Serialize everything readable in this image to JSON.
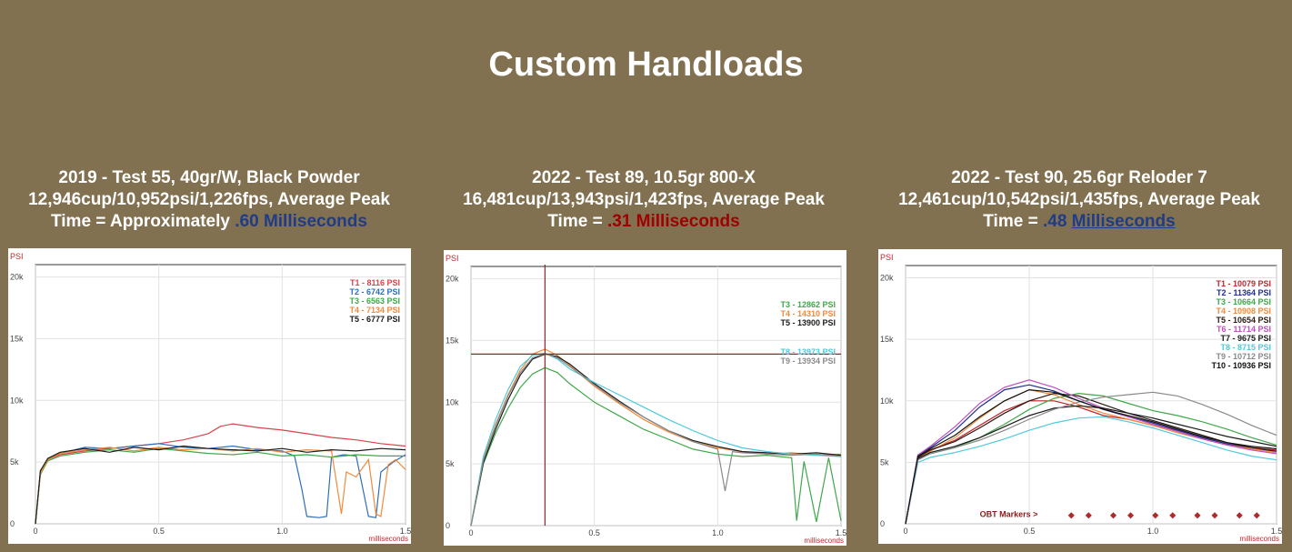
{
  "page_title": "Custom Handloads",
  "panels": [
    {
      "caption_line1": "2019 - Test 55, 40gr/W, Black Powder",
      "caption_line2": "12,946cup/10,952psi/1,226fps, Average Peak",
      "caption_time_prefix": "Time = Approximately",
      "caption_time_value": ".60",
      "caption_time_unit": "Milliseconds"
    },
    {
      "caption_line1": "2022 - Test 89, 10.5gr 800-X",
      "caption_line2": "16,481cup/13,943psi/1,423fps, Average Peak",
      "caption_time_prefix": "Time =",
      "caption_time_value": ".31",
      "caption_time_unit": "Milliseconds"
    },
    {
      "caption_line1": "2022 - Test 90, 25.6gr Reloder 7",
      "caption_line2": "12,461cup/10,542psi/1,435fps, Average Peak",
      "caption_time_prefix": "Time =",
      "caption_time_value": ".48",
      "caption_time_unit": "Milliseconds"
    }
  ],
  "chart_data": [
    {
      "type": "line",
      "ylabel": "PSI",
      "xlabel": "milliseconds",
      "xlim": [
        0,
        1.5
      ],
      "ylim": [
        0,
        21000
      ],
      "x_ticks": [
        "0",
        "0.5",
        "1.0",
        "1.5"
      ],
      "y_ticks": [
        "0",
        "5k",
        "10k",
        "15k",
        "20k"
      ],
      "grid": true,
      "legend_position": "top-right",
      "series": [
        {
          "name": "T1 -  8116 PSI",
          "color": "#d9434b",
          "x": [
            0,
            0.02,
            0.05,
            0.1,
            0.2,
            0.3,
            0.4,
            0.5,
            0.6,
            0.7,
            0.75,
            0.8,
            0.9,
            1.0,
            1.1,
            1.2,
            1.3,
            1.4,
            1.5
          ],
          "y": [
            0,
            4000,
            5200,
            5600,
            5900,
            6100,
            6300,
            6500,
            6800,
            7300,
            7900,
            8100,
            7800,
            7600,
            7300,
            7000,
            6800,
            6500,
            6300
          ]
        },
        {
          "name": "T2 -  6742 PSI",
          "color": "#2f6fb5",
          "x": [
            0,
            0.02,
            0.05,
            0.1,
            0.2,
            0.3,
            0.4,
            0.5,
            0.6,
            0.7,
            0.8,
            0.9,
            1.0,
            1.05,
            1.08,
            1.1,
            1.15,
            1.18,
            1.2,
            1.25,
            1.3,
            1.35,
            1.38,
            1.4,
            1.45,
            1.5
          ],
          "y": [
            0,
            4200,
            5300,
            5700,
            6200,
            6100,
            6300,
            6500,
            6200,
            6100,
            6300,
            6000,
            5900,
            5500,
            2800,
            600,
            500,
            600,
            5400,
            5600,
            5500,
            600,
            500,
            4200,
            5000,
            5600
          ]
        },
        {
          "name": "T3 -  6563 PSI",
          "color": "#3fa84a",
          "x": [
            0,
            0.02,
            0.05,
            0.1,
            0.2,
            0.3,
            0.4,
            0.5,
            0.6,
            0.7,
            0.8,
            0.9,
            1.0,
            1.1,
            1.2,
            1.3,
            1.4,
            1.5
          ],
          "y": [
            0,
            4000,
            5100,
            5500,
            5800,
            6000,
            5800,
            6100,
            5900,
            5700,
            5600,
            5800,
            5500,
            5600,
            5400,
            5600,
            5500,
            5500
          ]
        },
        {
          "name": "T4 -  7134 PSI",
          "color": "#f28a3b",
          "x": [
            0,
            0.02,
            0.05,
            0.1,
            0.2,
            0.3,
            0.4,
            0.5,
            0.6,
            0.7,
            0.8,
            0.9,
            1.0,
            1.1,
            1.2,
            1.24,
            1.26,
            1.3,
            1.35,
            1.38,
            1.4,
            1.43,
            1.46,
            1.5
          ],
          "y": [
            0,
            4100,
            5200,
            5700,
            6000,
            6200,
            5900,
            6200,
            6000,
            6100,
            5900,
            6100,
            5800,
            6000,
            5900,
            800,
            4200,
            3800,
            5200,
            800,
            600,
            4800,
            5200,
            4400
          ]
        },
        {
          "name": "T5 -  6777 PSI",
          "color": "#1b1b1b",
          "x": [
            0,
            0.02,
            0.05,
            0.1,
            0.2,
            0.3,
            0.4,
            0.5,
            0.6,
            0.7,
            0.8,
            0.9,
            1.0,
            1.1,
            1.2,
            1.3,
            1.4,
            1.5
          ],
          "y": [
            0,
            4300,
            5300,
            5800,
            6100,
            5800,
            6200,
            6000,
            6300,
            6100,
            6000,
            5900,
            6100,
            5800,
            6000,
            5900,
            6100,
            6000
          ]
        }
      ]
    },
    {
      "type": "line",
      "ylabel": "PSI",
      "xlabel": "milliseconds",
      "xlim": [
        0,
        1.5
      ],
      "ylim": [
        0,
        21000
      ],
      "x_ticks": [
        "0",
        "0.5",
        "1.0",
        "1.5"
      ],
      "y_ticks": [
        "0",
        "5k",
        "10k",
        "15k",
        "20k"
      ],
      "grid": true,
      "legend_position": "right",
      "cursor": {
        "x": 0.3,
        "y": 13900,
        "color": "#8b2a2a"
      },
      "series": [
        {
          "name": "T3 -  12862 PSI",
          "color": "#3fa84a",
          "x": [
            0,
            0.05,
            0.1,
            0.15,
            0.2,
            0.25,
            0.3,
            0.35,
            0.4,
            0.5,
            0.6,
            0.7,
            0.8,
            0.9,
            1.0,
            1.1,
            1.2,
            1.3,
            1.32,
            1.35,
            1.4,
            1.45,
            1.5
          ],
          "y": [
            0,
            5000,
            7500,
            9500,
            11200,
            12300,
            12800,
            12400,
            11500,
            10000,
            8900,
            7800,
            7000,
            6200,
            5800,
            5600,
            5700,
            5500,
            400,
            5200,
            300,
            5500,
            400
          ]
        },
        {
          "name": "T4 -  14310 PSI",
          "color": "#f28a3b",
          "x": [
            0,
            0.05,
            0.1,
            0.15,
            0.2,
            0.25,
            0.3,
            0.35,
            0.4,
            0.5,
            0.6,
            0.7,
            0.8,
            0.9,
            1.0,
            1.1,
            1.2,
            1.3,
            1.4,
            1.5
          ],
          "y": [
            0,
            5400,
            8200,
            10600,
            12600,
            13900,
            14300,
            13800,
            13000,
            11300,
            9900,
            8600,
            7600,
            6800,
            6300,
            6000,
            5800,
            5900,
            5700,
            5800
          ]
        },
        {
          "name": "T5 -  13900 PSI",
          "color": "#1b1b1b",
          "x": [
            0,
            0.05,
            0.1,
            0.15,
            0.2,
            0.25,
            0.3,
            0.35,
            0.4,
            0.5,
            0.6,
            0.7,
            0.8,
            0.9,
            1.0,
            1.1,
            1.2,
            1.3,
            1.4,
            1.5
          ],
          "y": [
            0,
            5100,
            7800,
            10200,
            12200,
            13500,
            13900,
            13700,
            13100,
            11500,
            10100,
            8800,
            7700,
            6900,
            6400,
            6000,
            5900,
            5800,
            5900,
            5700
          ]
        },
        {
          "name": "T8 -  13973 PSI",
          "color": "#4fc9dc",
          "x": [
            0,
            0.05,
            0.1,
            0.15,
            0.2,
            0.25,
            0.3,
            0.35,
            0.4,
            0.5,
            0.6,
            0.7,
            0.8,
            0.9,
            1.0,
            1.1,
            1.2,
            1.3,
            1.4,
            1.5
          ],
          "y": [
            0,
            5600,
            8600,
            11000,
            12900,
            13800,
            13970,
            13500,
            12700,
            11600,
            10600,
            9600,
            8600,
            7700,
            6900,
            6300,
            6000,
            5800,
            5700,
            5600
          ]
        },
        {
          "name": "T9 -  13934 PSI",
          "color": "#8a8a8a",
          "x": [
            0,
            0.05,
            0.1,
            0.15,
            0.2,
            0.25,
            0.3,
            0.35,
            0.4,
            0.5,
            0.6,
            0.7,
            0.8,
            0.9,
            1.0,
            1.03,
            1.06,
            1.1,
            1.2,
            1.3,
            1.4,
            1.5
          ],
          "y": [
            0,
            5300,
            8100,
            10500,
            12400,
            13600,
            13930,
            13600,
            12900,
            11400,
            10000,
            8800,
            7700,
            6800,
            6200,
            2800,
            6000,
            5900,
            5800,
            5700,
            5800,
            5600
          ]
        }
      ]
    },
    {
      "type": "line",
      "ylabel": "PSI",
      "xlabel": "milliseconds",
      "xlim": [
        0,
        1.5
      ],
      "ylim": [
        0,
        21000
      ],
      "x_ticks": [
        "0",
        "0.5",
        "1.0",
        "1.5"
      ],
      "y_ticks": [
        "0",
        "5k",
        "10k",
        "15k",
        "20k"
      ],
      "grid": true,
      "legend_position": "top-right",
      "obt_label": "OBT Markers >",
      "obt_markers": [
        0.67,
        0.74,
        0.84,
        0.91,
        1.01,
        1.08,
        1.18,
        1.25,
        1.35,
        1.42
      ],
      "series": [
        {
          "name": "T1 -  10079 PSI",
          "color": "#c1272d",
          "x": [
            0,
            0.05,
            0.1,
            0.2,
            0.3,
            0.4,
            0.5,
            0.6,
            0.7,
            0.8,
            0.9,
            1.0,
            1.1,
            1.2,
            1.3,
            1.4,
            1.5
          ],
          "y": [
            0,
            5500,
            6000,
            6800,
            8000,
            9200,
            10000,
            10000,
            9500,
            8800,
            8500,
            8000,
            7600,
            7000,
            6500,
            6200,
            6000
          ]
        },
        {
          "name": "T2 -  11364 PSI",
          "color": "#1f2f8f",
          "x": [
            0,
            0.05,
            0.1,
            0.2,
            0.3,
            0.4,
            0.5,
            0.6,
            0.7,
            0.8,
            0.9,
            1.0,
            1.1,
            1.2,
            1.3,
            1.4,
            1.5
          ],
          "y": [
            0,
            5600,
            6200,
            7600,
            9500,
            10900,
            11300,
            10800,
            10000,
            9300,
            8700,
            8200,
            7600,
            7000,
            6500,
            6100,
            5900
          ]
        },
        {
          "name": "T3 -  10664 PSI",
          "color": "#3fa84a",
          "x": [
            0,
            0.05,
            0.1,
            0.2,
            0.3,
            0.4,
            0.5,
            0.6,
            0.7,
            0.8,
            0.9,
            1.0,
            1.1,
            1.2,
            1.3,
            1.4,
            1.5
          ],
          "y": [
            0,
            5200,
            5700,
            6200,
            7000,
            8100,
            9300,
            10200,
            10600,
            10400,
            9800,
            9200,
            8800,
            8300,
            7700,
            7000,
            6400
          ]
        },
        {
          "name": "T4 -  10908 PSI",
          "color": "#f28a3b",
          "x": [
            0,
            0.05,
            0.1,
            0.2,
            0.3,
            0.4,
            0.5,
            0.6,
            0.7,
            0.8,
            0.9,
            1.0,
            1.1,
            1.2,
            1.3,
            1.4,
            1.5
          ],
          "y": [
            0,
            5300,
            5900,
            7000,
            8600,
            10000,
            10900,
            10500,
            9700,
            9000,
            8500,
            8000,
            7400,
            6900,
            6400,
            6100,
            5800
          ]
        },
        {
          "name": "T5 -  10654 PSI",
          "color": "#2b1a14",
          "x": [
            0,
            0.05,
            0.1,
            0.2,
            0.3,
            0.4,
            0.5,
            0.6,
            0.7,
            0.8,
            0.9,
            1.0,
            1.1,
            1.2,
            1.3,
            1.4,
            1.5
          ],
          "y": [
            0,
            5400,
            6000,
            6700,
            7800,
            9000,
            10000,
            10600,
            10400,
            9700,
            9000,
            8400,
            7800,
            7200,
            6600,
            6200,
            5900
          ]
        },
        {
          "name": "T6 -  11714 PSI",
          "color": "#c04fc0",
          "x": [
            0,
            0.05,
            0.1,
            0.2,
            0.3,
            0.4,
            0.5,
            0.6,
            0.7,
            0.8,
            0.9,
            1.0,
            1.1,
            1.2,
            1.3,
            1.4,
            1.5
          ],
          "y": [
            0,
            5600,
            6300,
            7900,
            9800,
            11100,
            11700,
            11100,
            10200,
            9400,
            8700,
            8100,
            7500,
            6900,
            6400,
            6000,
            5700
          ]
        },
        {
          "name": "T7 -   9675 PSI",
          "color": "#1b1b1b",
          "x": [
            0,
            0.05,
            0.1,
            0.2,
            0.3,
            0.4,
            0.5,
            0.6,
            0.7,
            0.8,
            0.9,
            1.0,
            1.1,
            1.2,
            1.3,
            1.4,
            1.5
          ],
          "y": [
            0,
            5300,
            5800,
            6300,
            7000,
            7900,
            8800,
            9400,
            9600,
            9400,
            9000,
            8600,
            8100,
            7600,
            7100,
            6700,
            6300
          ]
        },
        {
          "name": "T8 -   8715 PSI",
          "color": "#4fc9dc",
          "x": [
            0,
            0.05,
            0.1,
            0.2,
            0.3,
            0.4,
            0.5,
            0.6,
            0.7,
            0.8,
            0.9,
            1.0,
            1.1,
            1.2,
            1.3,
            1.4,
            1.5
          ],
          "y": [
            0,
            5000,
            5400,
            5800,
            6300,
            6900,
            7600,
            8200,
            8600,
            8700,
            8300,
            7800,
            7200,
            6600,
            6000,
            5500,
            5200
          ]
        },
        {
          "name": "T9 -  10712 PSI",
          "color": "#8a8a8a",
          "x": [
            0,
            0.05,
            0.1,
            0.2,
            0.3,
            0.4,
            0.5,
            0.6,
            0.7,
            0.8,
            0.9,
            1.0,
            1.1,
            1.2,
            1.3,
            1.4,
            1.5
          ],
          "y": [
            0,
            5200,
            5700,
            6200,
            6800,
            7600,
            8500,
            9300,
            9900,
            10300,
            10500,
            10700,
            10400,
            9700,
            8900,
            8000,
            7200
          ]
        },
        {
          "name": "T10 -  10936 PSI",
          "color": "#111111",
          "x": [
            0,
            0.05,
            0.1,
            0.2,
            0.3,
            0.4,
            0.5,
            0.6,
            0.7,
            0.8,
            0.9,
            1.0,
            1.1,
            1.2,
            1.3,
            1.4,
            1.5
          ],
          "y": [
            0,
            5500,
            6100,
            7200,
            8700,
            10000,
            10900,
            10700,
            10000,
            9300,
            8800,
            8300,
            7700,
            7100,
            6600,
            6300,
            6100
          ]
        }
      ]
    }
  ]
}
